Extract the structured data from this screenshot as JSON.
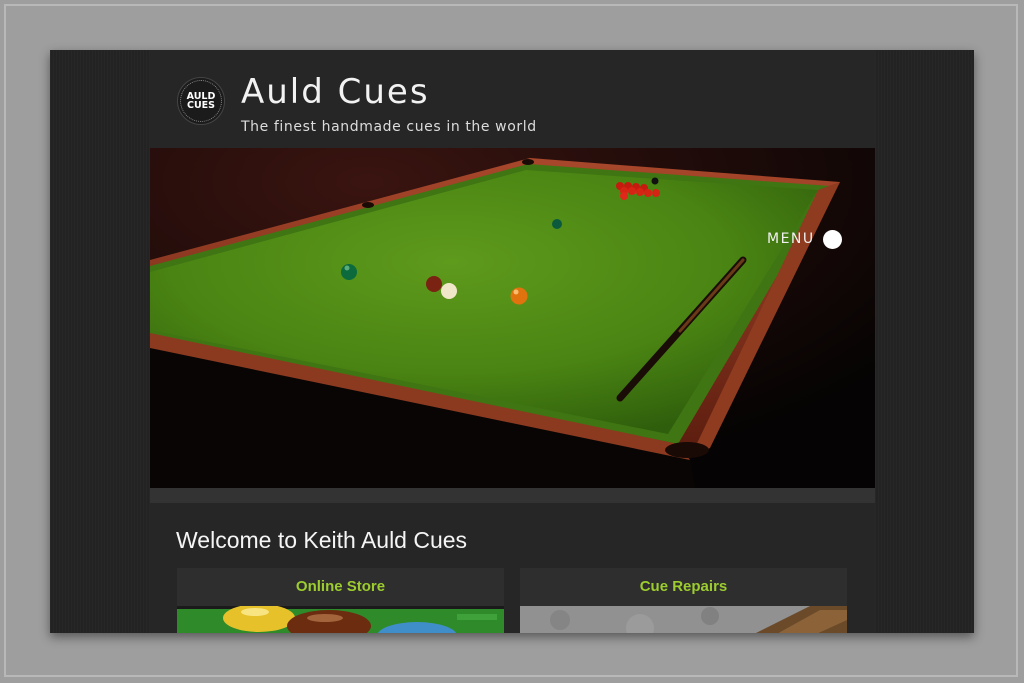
{
  "site": {
    "logo_line1": "AULD",
    "logo_line2": "CUES",
    "title": "Auld Cues",
    "tagline": "The finest handmade cues in the world"
  },
  "nav": {
    "menu_label": "MENU"
  },
  "hero": {
    "image": "snooker-table-photo"
  },
  "main": {
    "heading": "Welcome to Keith Auld Cues",
    "cards": [
      {
        "title": "Online Store",
        "image": "snooker-balls-photo"
      },
      {
        "title": "Cue Repairs",
        "image": "cue-wood-photo"
      }
    ]
  },
  "colors": {
    "background": "#262626",
    "accent": "#9ccc2e",
    "felt": "#4f8a16"
  }
}
